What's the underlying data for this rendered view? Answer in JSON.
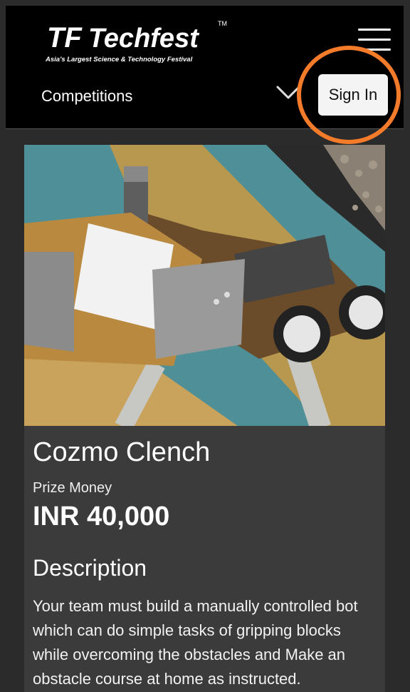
{
  "header": {
    "logo_text": "Techfest",
    "logo_tagline": "Asia's Largest Science & Technology Festival",
    "logo_mark": "TF",
    "nav_label": "Competitions",
    "signin_label": "Sign In"
  },
  "competition": {
    "title": "Cozmo Clench",
    "prize_label": "Prize Money",
    "prize_value": "INR 40,000",
    "description_heading": "Description",
    "description_text": "Your team must build a manually controlled bot which can do simple tasks of gripping blocks while overcoming the obstacles and Make an obstacle course at home as instructed."
  },
  "colors": {
    "highlight": "#f47b2a",
    "topbar": "#000000",
    "card": "#3b3b3b"
  }
}
